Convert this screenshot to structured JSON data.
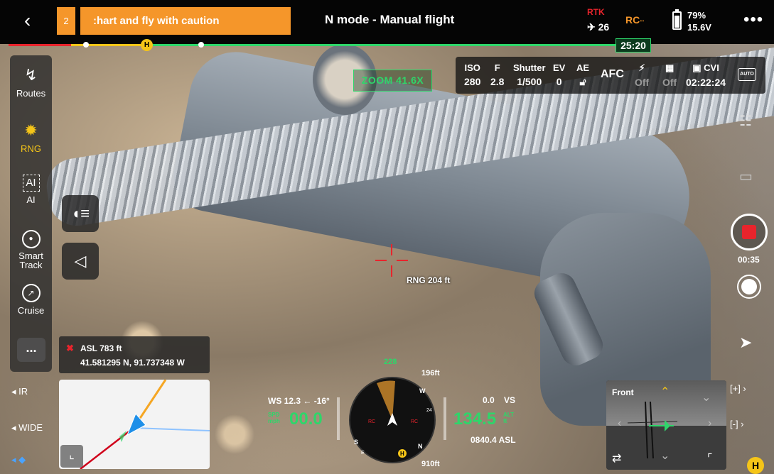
{
  "topbar": {
    "warning_count": "2",
    "warning_message": ":hart and fly with caution",
    "mode_title": "N mode - Manual flight",
    "rtk_label": "RTK",
    "rtk_satellites": "26",
    "rc_label": "RC",
    "battery_percent": "79%",
    "battery_voltage": "15.6V"
  },
  "progress": {
    "flight_time": "25:20",
    "home_marker": "H"
  },
  "sidebar": {
    "items": [
      {
        "label": "Routes",
        "icon": "routes-icon"
      },
      {
        "label": "RNG",
        "icon": "rng-icon"
      },
      {
        "label": "AI",
        "icon": "ai-icon"
      },
      {
        "label": "Smart Track",
        "icon": "smart-track-icon"
      },
      {
        "label": "Cruise",
        "icon": "cruise-icon"
      }
    ],
    "more_label": "..."
  },
  "lens": {
    "ir": "IR",
    "wide": "WIDE"
  },
  "position": {
    "asl": "ASL 783 ft",
    "latlon": "41.581295 N, 91.737348 W"
  },
  "zoom": {
    "label": "ZOOM 41.6X"
  },
  "camera": {
    "iso_label": "ISO",
    "iso_value": "280",
    "f_label": "F",
    "f_value": "2.8",
    "shutter_label": "Shutter",
    "shutter_value": "1/500",
    "ev_label": "EV",
    "ev_value": "0",
    "ae_label": "AE",
    "focus_mode": "AFC",
    "off1": "Off",
    "off2": "Off",
    "storage_label": "CVI",
    "storage_time": "02:22:24",
    "auto_label": "AUTO"
  },
  "reticle": {
    "range": "RNG 204 ft"
  },
  "recording": {
    "time": "00:35"
  },
  "telemetry": {
    "wind": "WS 12.3 ← -16°",
    "speed_label_top": "SPD",
    "speed_label_bottom": "mph",
    "speed": "00.0",
    "vs_value": "0.0",
    "vs_label": "VS",
    "altitude": "134.5",
    "alt_label_top": "ALT",
    "alt_label_bottom": "ft",
    "asl_value": "0840.4 ASL",
    "heading": "228",
    "home_dist_top": "196ft",
    "home_dist_bottom": "910ft"
  },
  "fpv": {
    "label": "Front"
  },
  "home_badge": "H",
  "colors": {
    "warning": "#f5962a",
    "accent_green": "#2ed66a",
    "alert_red": "#e8242c",
    "home_yellow": "#f5c518"
  }
}
